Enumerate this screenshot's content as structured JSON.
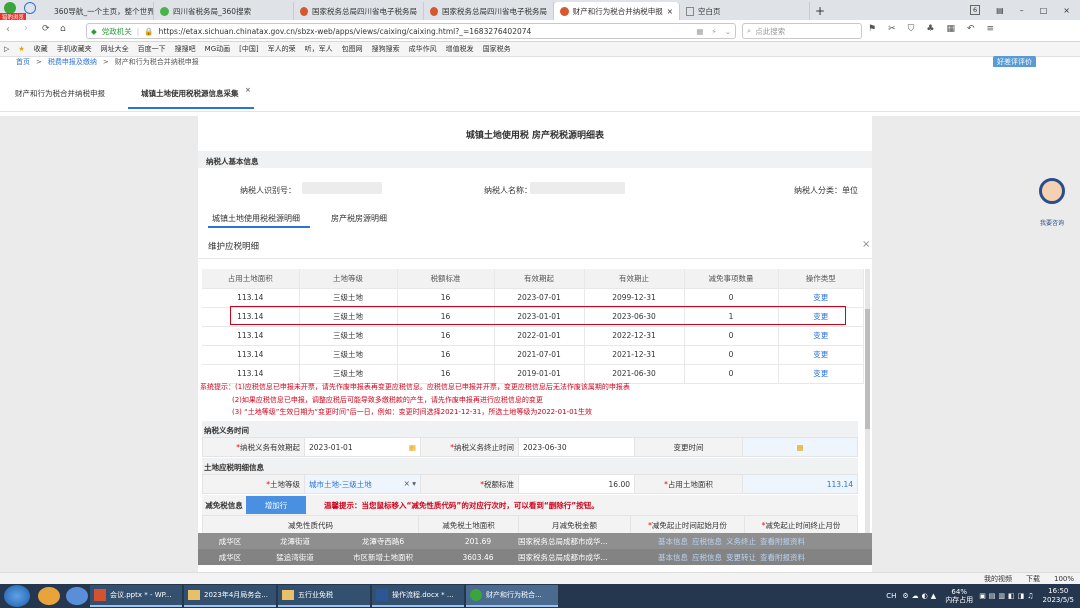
{
  "browser": {
    "badge": "猎豹浏览",
    "tabs": [
      {
        "label": "360导航_一个主页，整个世界",
        "active": false
      },
      {
        "label": "四川省税务局_360搜索",
        "active": false
      },
      {
        "label": "国家税务总局四川省电子税务局",
        "active": false
      },
      {
        "label": "国家税务总局四川省电子税务局",
        "active": false
      },
      {
        "label": "财产和行为税合并纳税申报",
        "active": true
      },
      {
        "label": "空白页",
        "active": false
      }
    ],
    "tab_count": "6",
    "security_label": "党政机关",
    "url": "https://etax.sichuan.chinatax.gov.cn/sbzx-web/apps/views/caixing/caixing.html?_=1683276402074",
    "search_placeholder": "点此搜索",
    "bookmarks": [
      "收藏",
      "手机收藏夹",
      "网址大全",
      "百度一下",
      "搜搜吧",
      "MG动画",
      "[中国]",
      "军人的荣",
      "听，军人",
      "包图网",
      "搜狗搜索",
      "成华作风",
      "增值税发",
      "国家税务"
    ],
    "breadcrumb": [
      "首页",
      "税费申报及缴纳",
      "财产和行为税合并纳税申报"
    ],
    "feedback_label": "好差评评价"
  },
  "app": {
    "tabs": [
      {
        "label": "财产和行为税合并纳税申报",
        "active": false
      },
      {
        "label": "城镇土地使用税税源信息采集",
        "active": true
      }
    ],
    "assistant_label": "我要咨询"
  },
  "form": {
    "title": "城镇土地使用税 房产税税源明细表",
    "taxpayer_section": "纳税人基本信息",
    "taxpayer_id_label": "纳税人识别号：",
    "taxpayer_name_label": "纳税人名称：",
    "taxpayer_type": "纳税人分类：单位",
    "subtabs": [
      "城镇土地使用税税源明细",
      "房产税房源明细"
    ]
  },
  "modal": {
    "title": "维护应税明细",
    "columns": [
      "占用土地面积",
      "土地等级",
      "税额标准",
      "有效期起",
      "有效期止",
      "减免事项数量",
      "操作类型"
    ],
    "rows": [
      [
        "113.14",
        "三级土地",
        "16",
        "2023-07-01",
        "2099-12-31",
        "0",
        "变更"
      ],
      [
        "113.14",
        "三级土地",
        "16",
        "2023-01-01",
        "2023-06-30",
        "1",
        "变更"
      ],
      [
        "113.14",
        "三级土地",
        "16",
        "2022-01-01",
        "2022-12-31",
        "0",
        "变更"
      ],
      [
        "113.14",
        "三级土地",
        "16",
        "2021-07-01",
        "2021-12-31",
        "0",
        "变更"
      ],
      [
        "113.14",
        "三级土地",
        "16",
        "2019-01-01",
        "2021-06-30",
        "0",
        "变更"
      ]
    ],
    "notices": [
      "系统提示：(1)应税信息已申报未开票，请先作废申报表再变更应税信息。应税信息已申报并开票，变更应税信息后无法作废该属期的申报表",
      "(2)如果应税信息已申报，调整应税后可能导致多缴税款的产生，请先作废申报再进行应税信息的变更",
      "(3) “土地等级”生效日期为“变更时间”后一日，例如：变更时间选择2021-12-31，所选土地等级为2022-01-01生效"
    ],
    "obligation_section": "纳税义务时间",
    "obligation_start_label": "纳税义务有效期起",
    "obligation_start_value": "2023-01-01",
    "obligation_end_label": "纳税义务终止时间",
    "obligation_end_value": "2023-06-30",
    "change_time_label": "变更时间",
    "detail_section": "土地应税明细信息",
    "land_grade_label": "土地等级",
    "land_grade_value": "城市土地-三级土地",
    "tax_standard_label": "税额标准",
    "tax_standard_value": "16.00",
    "area_label": "占用土地面积",
    "area_value": "113.14",
    "relief_label": "减免税信息",
    "add_row_label": "增加行",
    "tip": "温馨提示：当您鼠标移入“减免性质代码”的对应行次时，可以看到“删除行”按钮。",
    "relief_columns": [
      "减免性质代码",
      "减免税土地面积",
      "月减免税金额",
      "减免起止时间起始月份",
      "减免起止时间终止月份"
    ]
  },
  "background_rows": [
    [
      "成华区",
      "龙潭街道",
      "龙潭寺西路6",
      "201.69",
      "国家税务总局成都市成华...",
      "基本信息",
      "应税信息",
      "义务终止",
      "查看附报资料"
    ],
    [
      "成华区",
      "猛追湾街道",
      "市区新增土地面积",
      "3603.46",
      "国家税务总局成都市成华...",
      "基本信息",
      "应税信息",
      "变更转让",
      "查看附报资料"
    ]
  ],
  "status": {
    "items": [
      "我的视频",
      "下载",
      "100%"
    ]
  },
  "taskbar": {
    "tasks": [
      "会议.pptx * - WP...",
      "2023年4月局务会...",
      "五行业免税",
      "操作流程.docx * ...",
      "财产和行为税合..."
    ],
    "mem_pct": "64%",
    "mem_label": "内存占用",
    "lang": "CH",
    "time": "16:50",
    "date": "2023/5/5"
  },
  "colors": {
    "accent": "#2b73d6",
    "highlight": "#d0021b",
    "add_btn": "#4a90e2"
  }
}
